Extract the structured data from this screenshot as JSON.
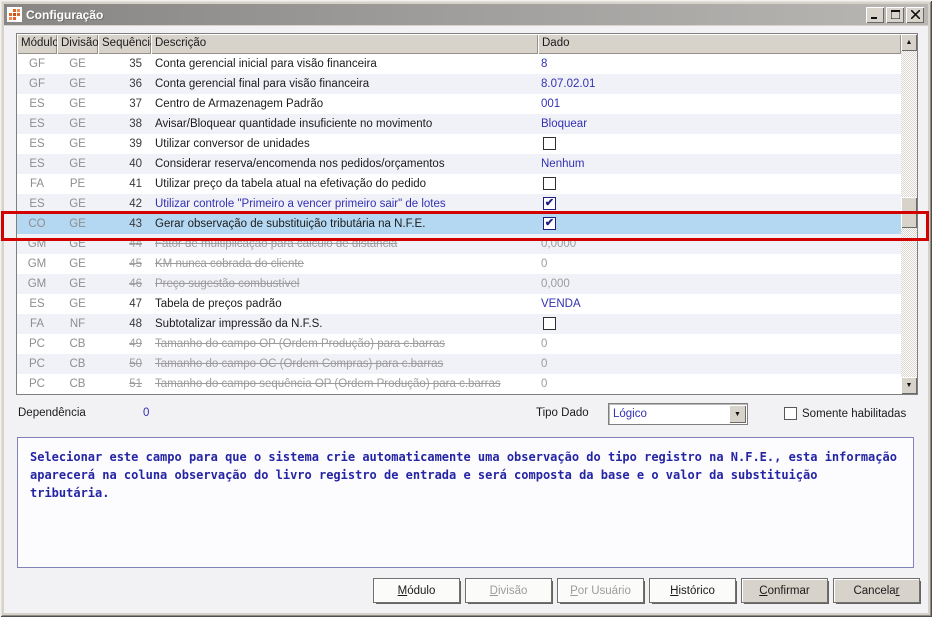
{
  "window": {
    "title": "Configuração"
  },
  "titlebar": {
    "buttons": [
      "minimize",
      "maximize",
      "close"
    ]
  },
  "table": {
    "columns": [
      "Módulo",
      "Divisão",
      "Sequência",
      "Descrição",
      "Dado"
    ],
    "rows": [
      {
        "module": "GF",
        "division": "GE",
        "seq": "35",
        "desc": "Conta gerencial inicial para visão financeira",
        "dado": {
          "type": "text",
          "value": "8"
        },
        "state": "normal"
      },
      {
        "module": "GF",
        "division": "GE",
        "seq": "36",
        "desc": "Conta gerencial final para visão financeira",
        "dado": {
          "type": "text",
          "value": "8.07.02.01"
        },
        "state": "normal"
      },
      {
        "module": "ES",
        "division": "GE",
        "seq": "37",
        "desc": "Centro de Armazenagem Padrão",
        "dado": {
          "type": "text",
          "value": "001"
        },
        "state": "normal"
      },
      {
        "module": "ES",
        "division": "GE",
        "seq": "38",
        "desc": "Avisar/Bloquear quantidade insuficiente no movimento",
        "dado": {
          "type": "text",
          "value": "Bloquear"
        },
        "state": "normal"
      },
      {
        "module": "ES",
        "division": "GE",
        "seq": "39",
        "desc": "Utilizar conversor de unidades",
        "dado": {
          "type": "checkbox",
          "value": false
        },
        "state": "normal"
      },
      {
        "module": "ES",
        "division": "GE",
        "seq": "40",
        "desc": "Considerar reserva/encomenda nos pedidos/orçamentos",
        "dado": {
          "type": "text",
          "value": "Nenhum"
        },
        "state": "normal"
      },
      {
        "module": "FA",
        "division": "PE",
        "seq": "41",
        "desc": "Utilizar preço da tabela atual na efetivação do pedido",
        "dado": {
          "type": "checkbox",
          "value": false
        },
        "state": "normal"
      },
      {
        "module": "ES",
        "division": "GE",
        "seq": "42",
        "desc": "Utilizar controle \"Primeiro a vencer primeiro sair\" de lotes",
        "dado": {
          "type": "checkbox",
          "value": true
        },
        "state": "link"
      },
      {
        "module": "CO",
        "division": "GE",
        "seq": "43",
        "desc": "Gerar observação de substituição tributária na N.F.E.",
        "dado": {
          "type": "checkbox",
          "value": true
        },
        "state": "selected"
      },
      {
        "module": "GM",
        "division": "GE",
        "seq": "44",
        "desc": "Fator de multiplicação para cálculo de distância",
        "dado": {
          "type": "text",
          "value": "0,0000"
        },
        "state": "disabled"
      },
      {
        "module": "GM",
        "division": "GE",
        "seq": "45",
        "desc": "KM nunca cobrada do cliente",
        "dado": {
          "type": "text",
          "value": "0"
        },
        "state": "disabled"
      },
      {
        "module": "GM",
        "division": "GE",
        "seq": "46",
        "desc": "Preço sugestão combustível",
        "dado": {
          "type": "text",
          "value": "0,000"
        },
        "state": "disabled"
      },
      {
        "module": "ES",
        "division": "GE",
        "seq": "47",
        "desc": "Tabela de preços padrão",
        "dado": {
          "type": "text",
          "value": "VENDA"
        },
        "state": "normal"
      },
      {
        "module": "FA",
        "division": "NF",
        "seq": "48",
        "desc": "Subtotalizar impressão da N.F.S.",
        "dado": {
          "type": "checkbox",
          "value": false
        },
        "state": "normal"
      },
      {
        "module": "PC",
        "division": "CB",
        "seq": "49",
        "desc": "Tamanho do campo OP (Ordem Produção) para c.barras",
        "dado": {
          "type": "text",
          "value": "0"
        },
        "state": "disabled"
      },
      {
        "module": "PC",
        "division": "CB",
        "seq": "50",
        "desc": "Tamanho do campo OC (Ordem Compras) para c.barras",
        "dado": {
          "type": "text",
          "value": "0"
        },
        "state": "disabled"
      },
      {
        "module": "PC",
        "division": "CB",
        "seq": "51",
        "desc": "Tamanho do campo sequência OP (Ordem Produção) para c.barras",
        "dado": {
          "type": "text",
          "value": "0"
        },
        "state": "disabled"
      }
    ]
  },
  "footer": {
    "dependencia_label": "Dependência",
    "dependencia_value": "0",
    "tipo_dado_label": "Tipo Dado",
    "tipo_dado_value": "Lógico",
    "somente_habilitadas_label": "Somente habilitadas",
    "somente_habilitadas_checked": false
  },
  "info_text": "Selecionar este campo para que o sistema crie automaticamente uma observação do tipo registro na N.F.E., esta informação aparecerá na coluna observação do livro registro de entrada e será composta da base e o valor da substituição tributária.",
  "buttons": [
    {
      "name": "modulo-button",
      "pre": "",
      "key": "M",
      "post": "ódulo",
      "enabled": true,
      "variant": "flat"
    },
    {
      "name": "divisao-button",
      "pre": "",
      "key": "D",
      "post": "ivisão",
      "enabled": false,
      "variant": "flat"
    },
    {
      "name": "por-usuario-button",
      "pre": "",
      "key": "P",
      "post": "or Usuário",
      "enabled": false,
      "variant": "flat"
    },
    {
      "name": "historico-button",
      "pre": "",
      "key": "H",
      "post": "istórico",
      "enabled": true,
      "variant": "flat"
    },
    {
      "name": "confirmar-button",
      "pre": "",
      "key": "C",
      "post": "onfirmar",
      "enabled": true,
      "variant": "beige"
    },
    {
      "name": "cancelar-button",
      "pre": "Cancela",
      "key": "r",
      "post": "",
      "enabled": true,
      "variant": "beige"
    }
  ],
  "icons": {
    "checkmark": "✔",
    "arrow_up": "▲",
    "arrow_down": "▼",
    "dropdown_arrow": "▼"
  },
  "colors": {
    "selection_blue": "#b4d8f2",
    "annotation_red": "#d30000",
    "dado_blue": "#3232b2",
    "disabled_gray": "#9c9c9c",
    "info_text_blue": "#2424a4",
    "titlebar_gray": "#878685"
  }
}
